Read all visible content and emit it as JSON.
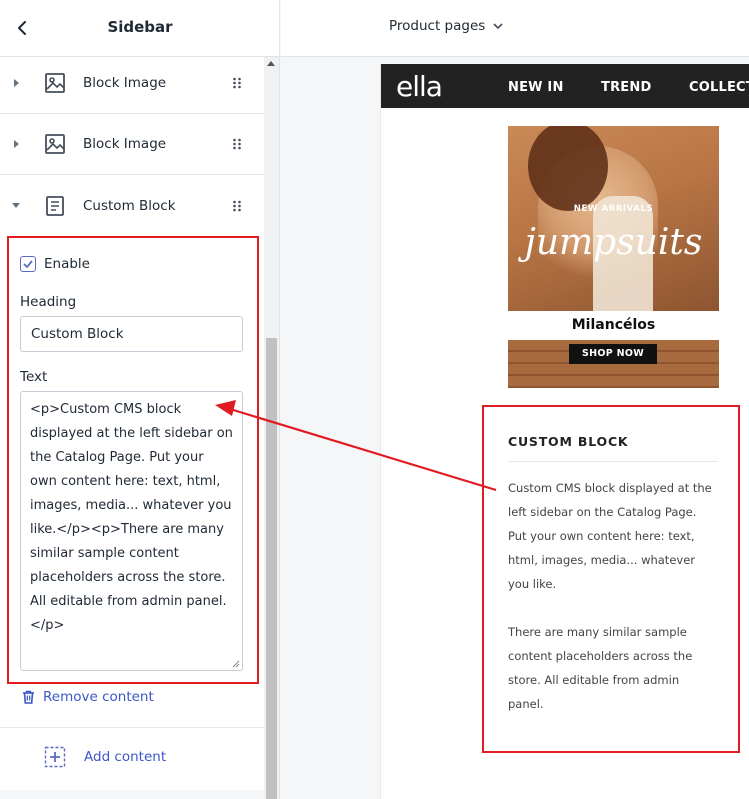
{
  "panel": {
    "title": "Sidebar",
    "blocks": [
      {
        "label": "Block Image",
        "icon": "image-icon",
        "expanded": false
      },
      {
        "label": "Block Image",
        "icon": "image-icon",
        "expanded": false
      },
      {
        "label": "Custom Block",
        "icon": "text-block-icon",
        "expanded": true
      }
    ],
    "settings": {
      "enable_label": "Enable",
      "enabled": true,
      "heading_label": "Heading",
      "heading_value": "Custom Block",
      "text_label": "Text",
      "text_value": "<p>Custom CMS block displayed at the left sidebar on the Catalog Page. Put your own content here: text, html, images, media... whatever you like.</p><p>There are many similar sample content placeholders across the store. All editable from admin panel.</p>"
    },
    "remove_label": "Remove content",
    "add_label": "Add content"
  },
  "topbar": {
    "page_select": "Product pages"
  },
  "store": {
    "logo": "ella",
    "nav": [
      "NEW IN",
      "TREND",
      "COLLECT"
    ],
    "promo": {
      "subtitle": "NEW ARRIVALS",
      "script": "jumpsuits",
      "brand": "Milancélos",
      "cta": "SHOP NOW"
    },
    "custom_block": {
      "heading": "CUSTOM BLOCK",
      "paragraph_1": "Custom CMS block displayed at the left sidebar on the Catalog Page. Put your own content here: text, html, images, media... whatever you like.",
      "paragraph_2": "There are many similar sample content placeholders across the store. All editable from admin panel."
    }
  },
  "colors": {
    "accent": "#5c6ac4",
    "link": "#3c57c8",
    "annotation": "#e11b22",
    "store_nav": "#222222"
  }
}
